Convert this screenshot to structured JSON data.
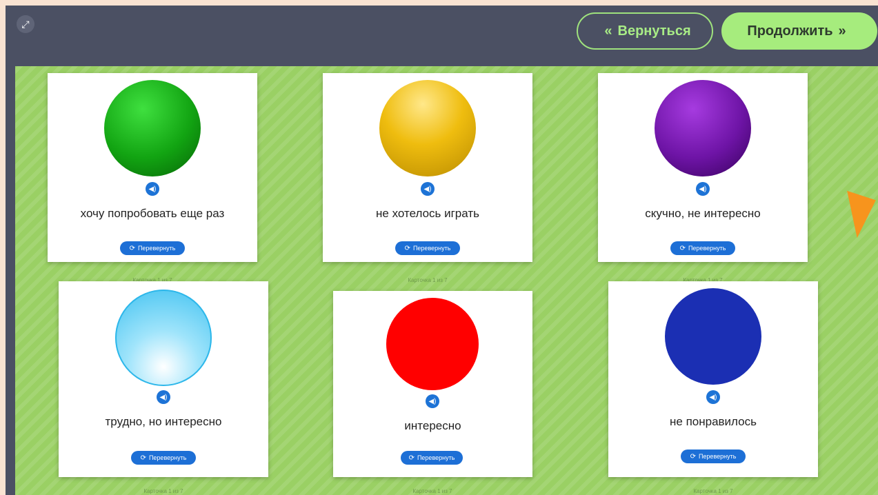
{
  "header": {
    "back_label": "Вернуться",
    "next_label": "Продолжить",
    "back_arrow": "«",
    "next_arrow": "»"
  },
  "icons": {
    "fullscreen": "expand-icon",
    "sound": "speaker-icon",
    "flip": "refresh-icon"
  },
  "cards": [
    {
      "caption": "хочу попробовать еще раз",
      "color": "green",
      "flip_label": "Перевернуть",
      "counter": "Карточка 1 из 7"
    },
    {
      "caption": "не хотелось играть",
      "color": "yellow",
      "flip_label": "Перевернуть",
      "counter": "Карточка 1 из 7"
    },
    {
      "caption": "скучно, не интересно",
      "color": "purple",
      "flip_label": "Перевернуть",
      "counter": "Карточка 1 из 7"
    },
    {
      "caption": "трудно, но интересно",
      "color": "light-blue",
      "flip_label": "Перевернуть",
      "counter": "Карточка 1 из 7"
    },
    {
      "caption": "интересно",
      "color": "red",
      "flip_label": "Перевернуть",
      "counter": "Карточка 1 из 7"
    },
    {
      "caption": "не понравилось",
      "color": "dark-blue",
      "flip_label": "Перевернуть",
      "counter": "Карточка 1 из 7"
    }
  ],
  "colors": {
    "green": "#12a412",
    "yellow": "#efbd0f",
    "purple": "#6e14a6",
    "light-blue": "#8fdcf7",
    "red": "#ff0000",
    "dark-blue": "#1b2fb3",
    "accent": "#1d73d6",
    "board": "#9ad064"
  }
}
